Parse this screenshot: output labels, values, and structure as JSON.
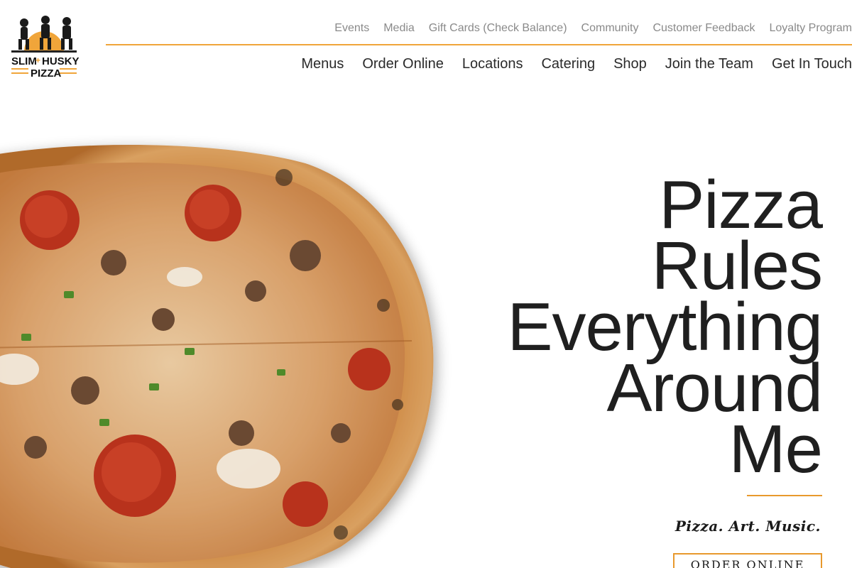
{
  "brand": {
    "logo_text_line1": "SLIM",
    "logo_text_plus": "+",
    "logo_text_line1b": "HUSKY'S",
    "logo_text_line2": "PIZZA",
    "logo_icon": "three-figures-sunset-logo",
    "accent_color": "#f0a53a"
  },
  "utility_nav": [
    {
      "label": "Events"
    },
    {
      "label": "Media"
    },
    {
      "label": "Gift Cards (Check Balance)"
    },
    {
      "label": "Community"
    },
    {
      "label": "Customer Feedback"
    },
    {
      "label": "Loyalty Program"
    }
  ],
  "main_nav": [
    {
      "label": "Menus"
    },
    {
      "label": "Order Online"
    },
    {
      "label": "Locations"
    },
    {
      "label": "Catering"
    },
    {
      "label": "Shop"
    },
    {
      "label": "Join the Team"
    },
    {
      "label": "Get In Touch"
    }
  ],
  "hero": {
    "title_lines": [
      "Pizza",
      "Rules",
      "Everything",
      "Around",
      "Me"
    ],
    "tagline": "Pizza. Art. Music.",
    "cta_label": "ORDER ONLINE",
    "image": "pizza-photo"
  }
}
